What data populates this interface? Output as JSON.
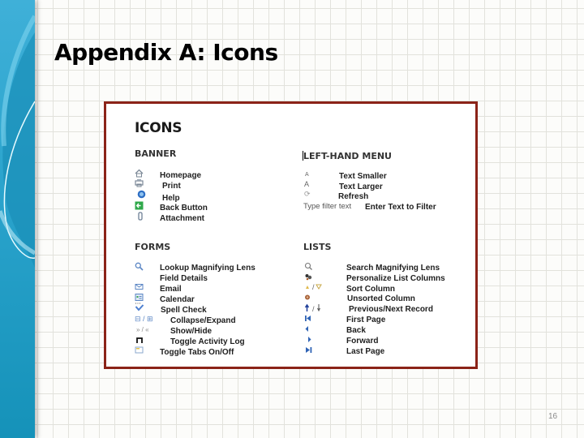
{
  "slide": {
    "title": "Appendix A: Icons",
    "page_number": "16"
  },
  "panel": {
    "heading": "ICONS",
    "sections": {
      "banner": {
        "title": "BANNER",
        "items": [
          {
            "icon": "home-icon",
            "label": "Homepage"
          },
          {
            "icon": "print-icon",
            "label": "Print"
          },
          {
            "icon": "help-icon",
            "label": "Help"
          },
          {
            "icon": "back-button-icon",
            "label": "Back Button"
          },
          {
            "icon": "attachment-icon",
            "label": "Attachment"
          }
        ]
      },
      "left_hand_menu": {
        "title": "LEFT-HAND MENU",
        "items": [
          {
            "icon": "text-smaller-icon",
            "glyph": "A",
            "label": "Text Smaller"
          },
          {
            "icon": "text-larger-icon",
            "glyph": "A",
            "label": "Text Larger"
          },
          {
            "icon": "refresh-icon",
            "glyph": "⟳",
            "label": "Refresh"
          }
        ],
        "filter": {
          "placeholder": "Type filter text",
          "label": "Enter Text to Filter"
        }
      },
      "forms": {
        "title": "FORMS",
        "items": [
          {
            "icon": "magnifying-lens-icon",
            "label": "Lookup Magnifying Lens"
          },
          {
            "icon": "",
            "label": "Field Details"
          },
          {
            "icon": "email-icon",
            "label": "Email"
          },
          {
            "icon": "calendar-icon",
            "label": "Calendar"
          },
          {
            "icon": "spell-check-icon",
            "label": "Spell Check"
          },
          {
            "icon": "collapse-expand-icon",
            "glyph": "⊟ / ⊞",
            "label": "Collapse/Expand"
          },
          {
            "icon": "show-hide-icon",
            "glyph": "» / «",
            "label": "Show/Hide"
          },
          {
            "icon": "activity-log-icon",
            "label": "Toggle Activity Log"
          },
          {
            "icon": "toggle-tabs-icon",
            "label": "Toggle Tabs On/Off"
          }
        ]
      },
      "lists": {
        "title": "LISTS",
        "items": [
          {
            "icon": "search-icon",
            "label": "Search Magnifying Lens"
          },
          {
            "icon": "personalize-columns-icon",
            "label": "Personalize List Columns"
          },
          {
            "icon": "sort-column-icon",
            "glyph": "/",
            "label": "Sort Column"
          },
          {
            "icon": "unsorted-column-icon",
            "label": "Unsorted Column"
          },
          {
            "icon": "previous-next-record-icon",
            "glyph": "/",
            "label": "Previous/Next Record"
          },
          {
            "icon": "first-page-icon",
            "label": "First Page"
          },
          {
            "icon": "back-icon",
            "label": "Back"
          },
          {
            "icon": "forward-icon",
            "label": "Forward"
          },
          {
            "icon": "last-page-icon",
            "label": "Last Page"
          }
        ]
      }
    }
  },
  "colors": {
    "sidebar_blue": "#2aa3cc",
    "panel_border": "#8b2318",
    "icon_blue": "#2f63b5",
    "icon_green": "#2fa84a"
  }
}
